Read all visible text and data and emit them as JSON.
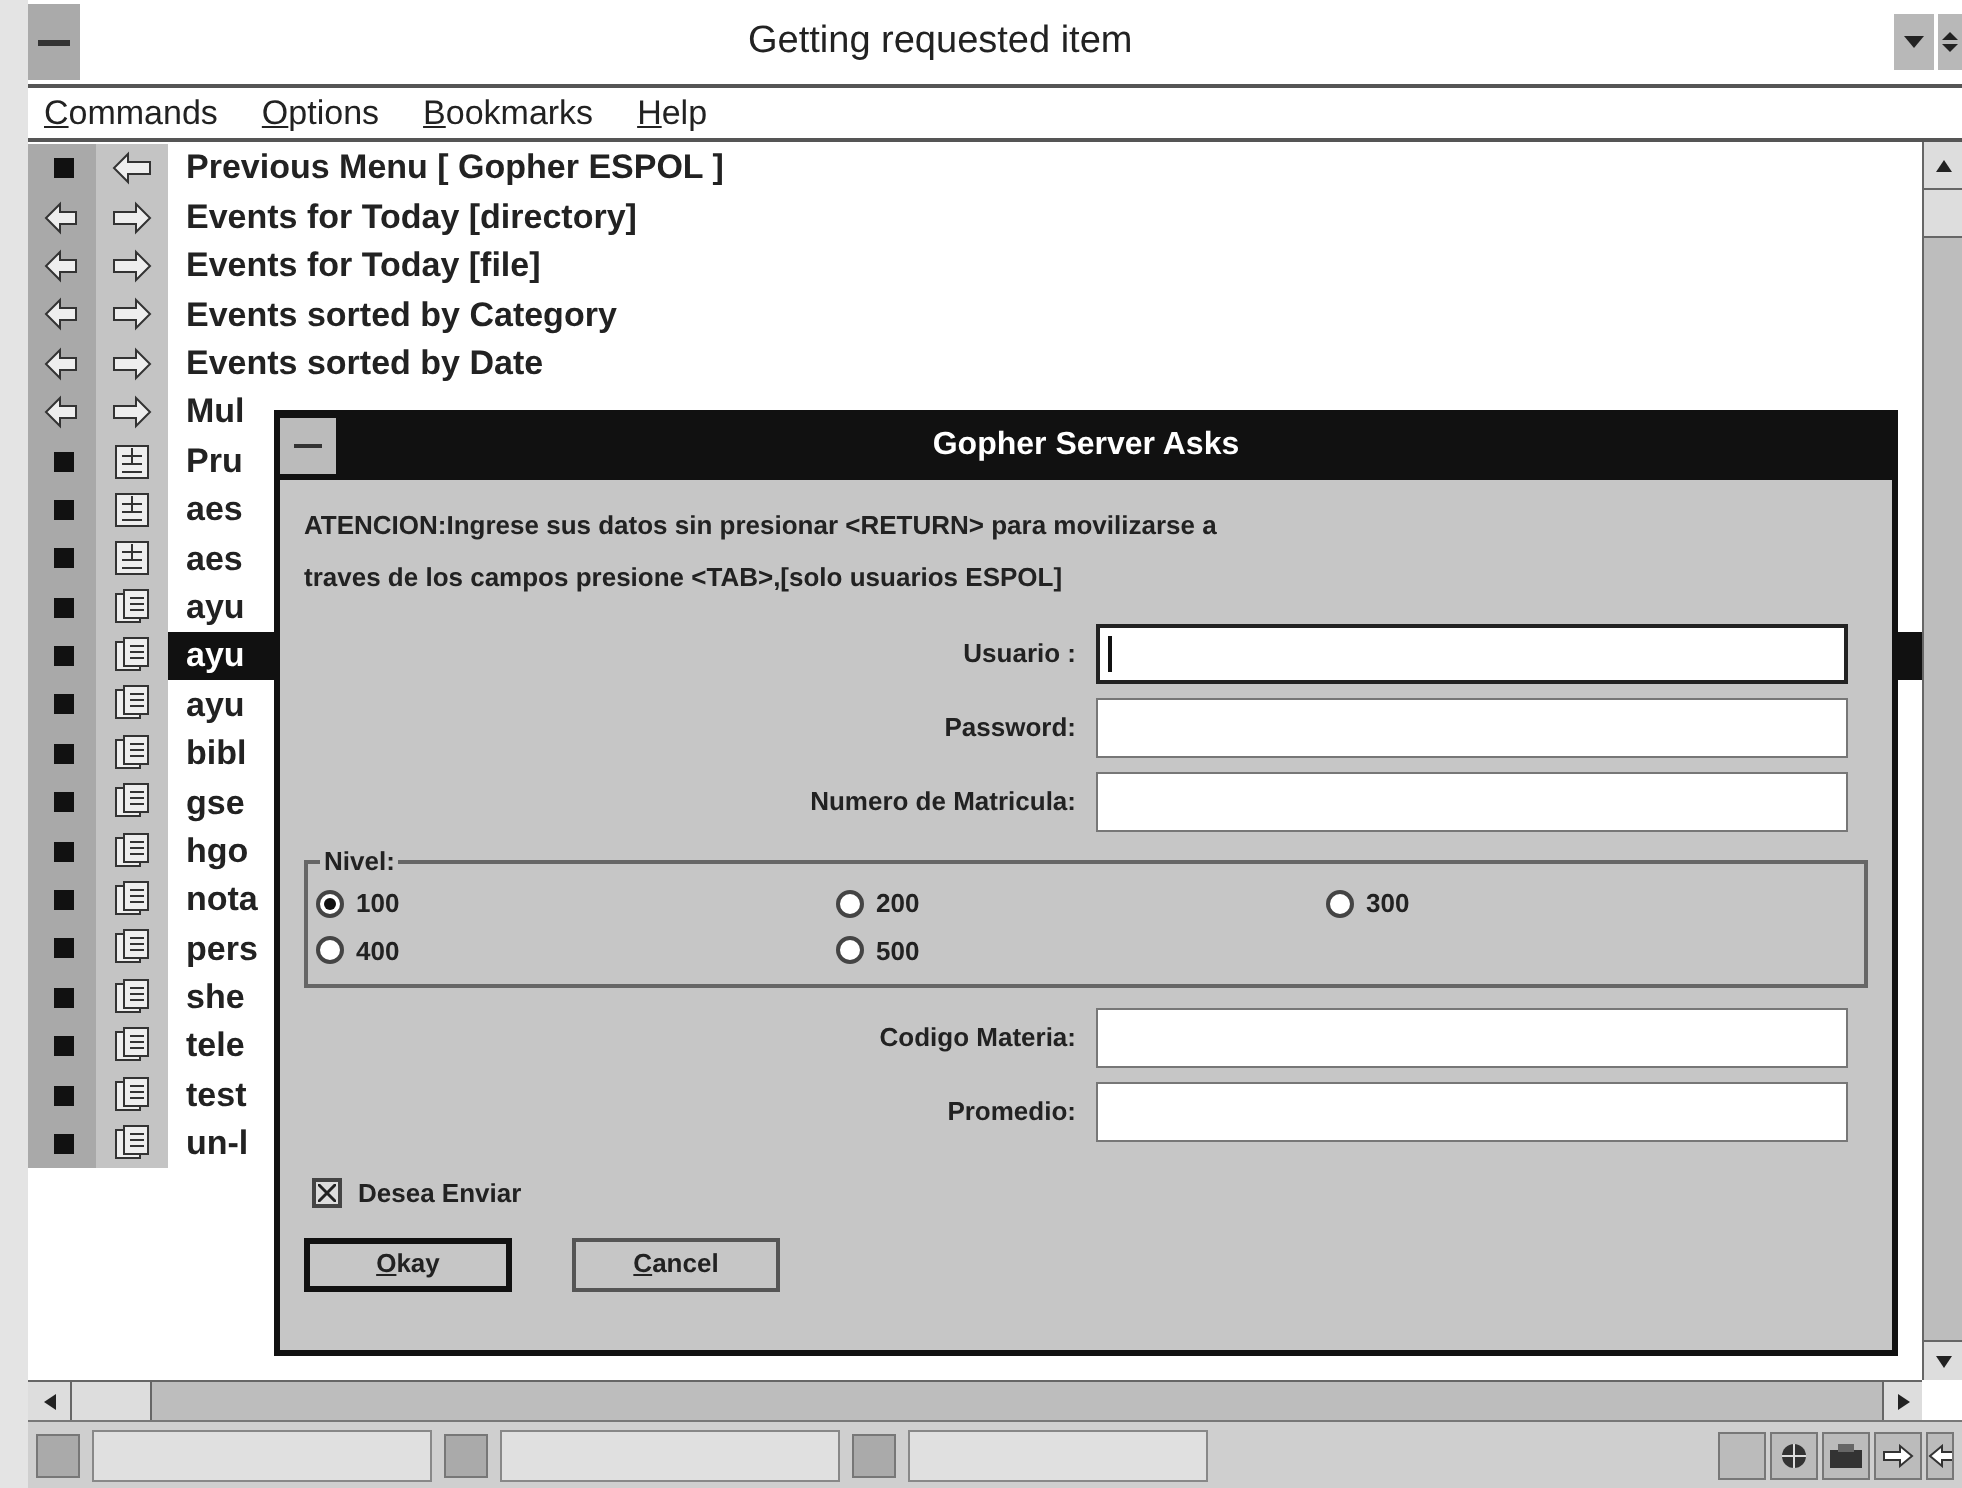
{
  "window": {
    "title": "Getting requested item"
  },
  "menu": [
    "Commands",
    "Options",
    "Bookmarks",
    "Help"
  ],
  "items": [
    {
      "kind": "back",
      "label": "Previous Menu [ Gopher ESPOL ]",
      "selected": false
    },
    {
      "kind": "directory",
      "label": "Events for Today [directory]",
      "selected": false
    },
    {
      "kind": "directory",
      "label": "Events for Today [file]",
      "selected": false
    },
    {
      "kind": "directory",
      "label": "Events sorted by Category",
      "selected": false
    },
    {
      "kind": "directory",
      "label": "Events sorted by Date",
      "selected": false
    },
    {
      "kind": "directory",
      "label": "Mul",
      "selected": false
    },
    {
      "kind": "search",
      "label": "Pru",
      "selected": false
    },
    {
      "kind": "search",
      "label": "aes",
      "selected": false
    },
    {
      "kind": "search",
      "label": "aes",
      "selected": false
    },
    {
      "kind": "document",
      "label": "ayu",
      "selected": false
    },
    {
      "kind": "document",
      "label": "ayu",
      "selected": true
    },
    {
      "kind": "document",
      "label": "ayu",
      "selected": false
    },
    {
      "kind": "document",
      "label": "bibl",
      "selected": false
    },
    {
      "kind": "document",
      "label": "gse",
      "selected": false
    },
    {
      "kind": "document",
      "label": "hgo",
      "selected": false
    },
    {
      "kind": "document",
      "label": "nota",
      "selected": false
    },
    {
      "kind": "document",
      "label": "pers",
      "selected": false
    },
    {
      "kind": "document",
      "label": "she",
      "selected": false
    },
    {
      "kind": "document",
      "label": "tele",
      "selected": false
    },
    {
      "kind": "document",
      "label": "test",
      "selected": false
    },
    {
      "kind": "document",
      "label": "un-l",
      "selected": false
    }
  ],
  "dialog": {
    "title": "Gopher Server Asks",
    "message": "ATENCION:Ingrese sus datos sin presionar <RETURN> para movilizarse a\ntraves de los campos presione <TAB>,[solo usuarios ESPOL]",
    "fields_top": [
      {
        "label": "Usuario :",
        "focused": true
      },
      {
        "label": "Password:",
        "focused": false
      },
      {
        "label": "Numero de Matricula:",
        "focused": false
      }
    ],
    "group": {
      "label": "Nivel:",
      "options": [
        {
          "label": "100",
          "selected": true
        },
        {
          "label": "200",
          "selected": false
        },
        {
          "label": "300",
          "selected": false
        },
        {
          "label": "400",
          "selected": false
        },
        {
          "label": "500",
          "selected": false
        }
      ]
    },
    "fields_bottom": [
      {
        "label": "Codigo Materia:",
        "focused": false
      },
      {
        "label": "Promedio:",
        "focused": false
      }
    ],
    "checkbox": {
      "label": "Desea Enviar",
      "checked": true
    },
    "buttons": [
      {
        "label": "Okay",
        "default": true
      },
      {
        "label": "Cancel",
        "default": false
      }
    ]
  }
}
